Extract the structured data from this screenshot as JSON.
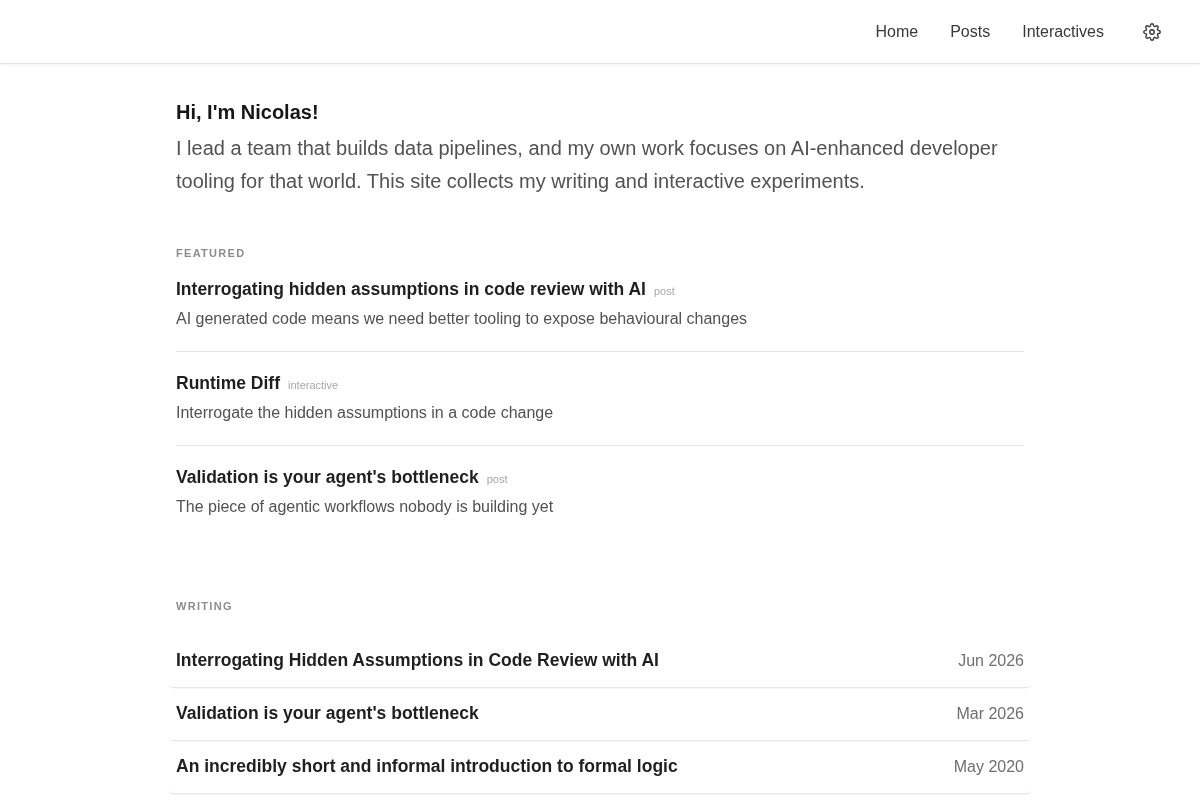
{
  "header": {
    "nav_links": [
      {
        "label": "Home"
      },
      {
        "label": "Posts"
      },
      {
        "label": "Interactives"
      }
    ]
  },
  "intro": {
    "greeting": "Hi, I'm Nicolas!",
    "text": "I lead a team that builds data pipelines, and my own work focuses on AI-enhanced developer tooling for that world. This site collects my writing and interactive experiments."
  },
  "featured": {
    "heading": "FEATURED",
    "items": [
      {
        "title": "Interrogating hidden assumptions in code review with AI",
        "tag": "post",
        "description": "AI generated code means we need better tooling to expose behavioural changes"
      },
      {
        "title": "Runtime Diff",
        "tag": "interactive",
        "description": "Interrogate the hidden assumptions in a code change"
      },
      {
        "title": "Validation is your agent's bottleneck",
        "tag": "post",
        "description": "The piece of agentic workflows nobody is building yet"
      }
    ]
  },
  "writing": {
    "heading": "WRITING",
    "rows": [
      {
        "title": "Interrogating Hidden Assumptions in Code Review with AI",
        "date": "Jun 2026"
      },
      {
        "title": "Validation is your agent's bottleneck",
        "date": "Mar 2026"
      },
      {
        "title": "An incredibly short and informal introduction to formal logic",
        "date": "May 2020"
      }
    ]
  }
}
